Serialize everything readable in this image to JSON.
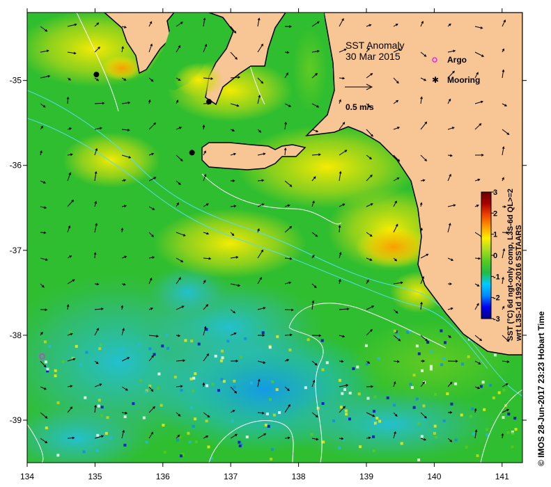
{
  "title": "SST Anomaly",
  "date": "30 Mar 2015",
  "scale_arrow_label": "0.5 m/s",
  "legend": {
    "argo_label": "Argo",
    "mooring_label": "Mooring",
    "argo_color": "#ee22ee",
    "mooring_color": "#000000"
  },
  "colorbar": {
    "min": -3,
    "max": 3,
    "ticks": [
      "3",
      "2",
      "1",
      "0",
      "-1",
      "-2",
      "-3"
    ],
    "label_lines": [
      "SST (°C) 6d ngt-only comp, L3S-6d QL>=2",
      "wrt L3S-1d 1992-2016 SSTAARS"
    ],
    "colors": [
      "#000080",
      "#0000ee",
      "#0088ff",
      "#00ccff",
      "#22bb44",
      "#55cc22",
      "#aadd22",
      "#ffee00",
      "#ff9900",
      "#ee4400",
      "#aa0000",
      "#660000"
    ]
  },
  "credit": "© IMOS 28-Jun-2017 23:23 Hobart Time",
  "axes": {
    "x_ticks": [
      "134",
      "135",
      "136",
      "137",
      "138",
      "139",
      "140",
      "141"
    ],
    "y_ticks": [
      "-35",
      "-36",
      "-37",
      "-38",
      "-39"
    ],
    "x_range": [
      134,
      141.3
    ],
    "y_range": [
      -39.5,
      -34.2
    ]
  },
  "markers": {
    "moorings": [
      [
        135.02,
        -34.93
      ],
      [
        136.68,
        -35.25
      ],
      [
        136.43,
        -35.85
      ]
    ],
    "argo": [
      [
        134.22,
        -38.25
      ]
    ]
  },
  "colors": {
    "land": "#f8c594",
    "ocean_base": "#2fbe2f",
    "frame": "#000000"
  }
}
